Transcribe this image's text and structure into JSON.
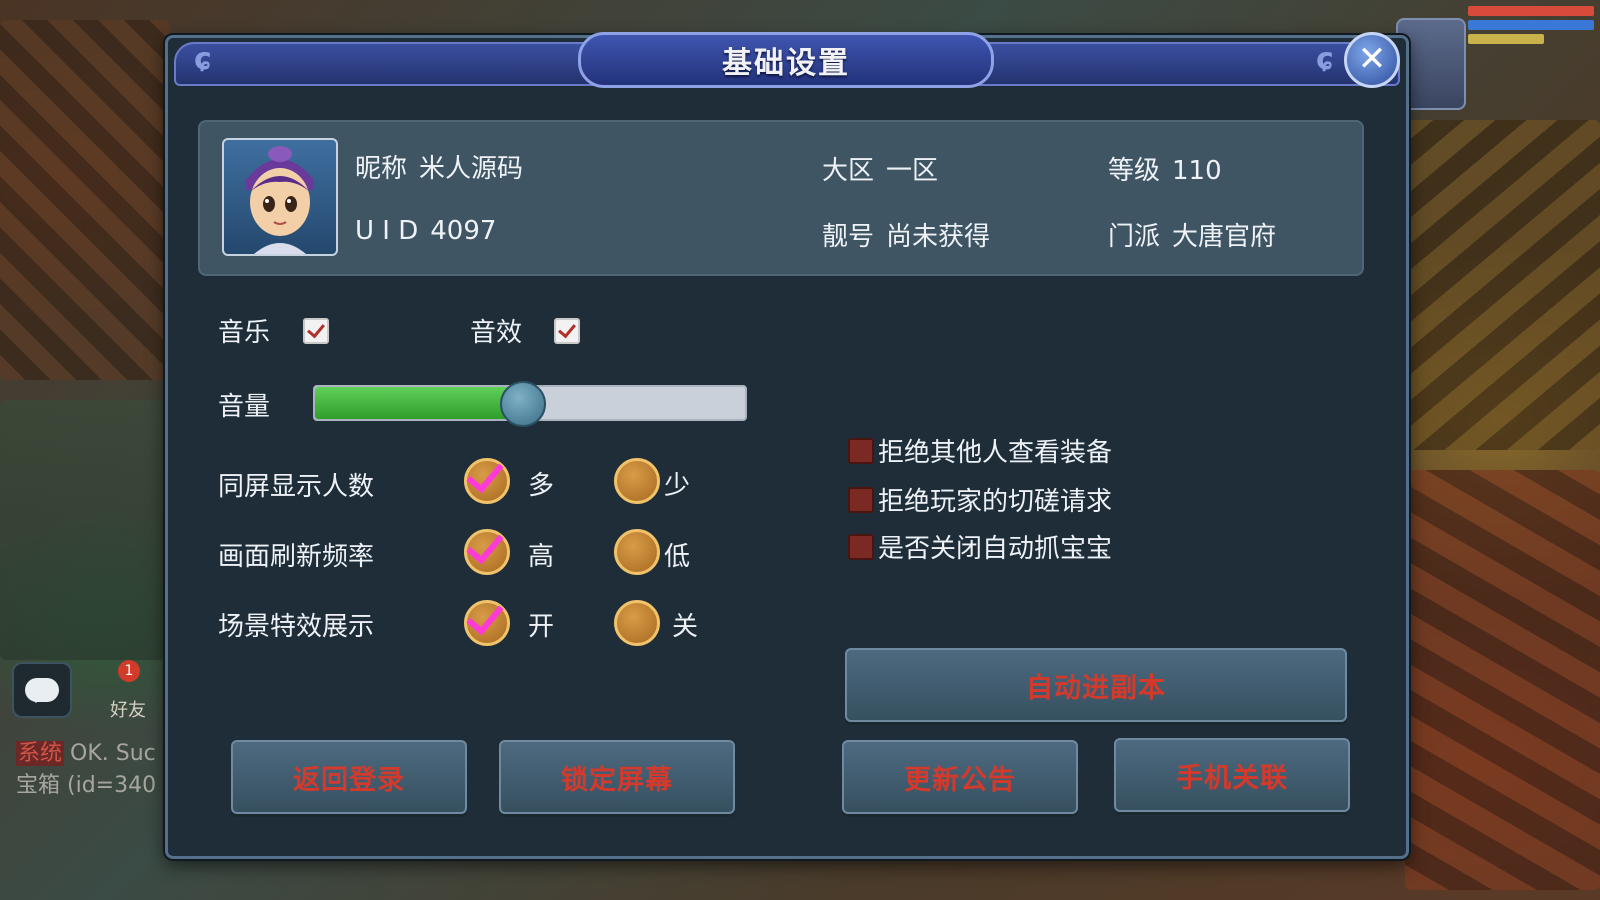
{
  "dialog": {
    "title": "基础设置",
    "close_icon": "✕"
  },
  "profile": {
    "nickname_label": "昵称",
    "nickname": "米人源码",
    "uid_label": "U I D",
    "uid": "4097",
    "region_label": "大区",
    "region": "一区",
    "handle_label": "靓号",
    "handle": "尚未获得",
    "level_label": "等级",
    "level": "110",
    "faction_label": "门派",
    "faction": "大唐官府"
  },
  "audio": {
    "music_label": "音乐",
    "music_checked": true,
    "sfx_label": "音效",
    "sfx_checked": true,
    "volume_label": "音量",
    "volume_fraction": 0.48
  },
  "display_options": [
    {
      "label": "同屏显示人数",
      "option_a": "多",
      "option_b": "少",
      "selected": "a"
    },
    {
      "label": "画面刷新频率",
      "option_a": "高",
      "option_b": "低",
      "selected": "a"
    },
    {
      "label": "场景特效展示",
      "option_a": "开",
      "option_b": "关",
      "selected": "a"
    }
  ],
  "privacy": {
    "refuse_view_equipment": "拒绝其他人查看装备",
    "refuse_duel": "拒绝玩家的切磋请求",
    "disable_auto_catch": "是否关闭自动抓宝宝"
  },
  "buttons": {
    "auto_dungeon": "自动进副本",
    "back_to_login": "返回登录",
    "lock_screen": "锁定屏幕",
    "update_notice": "更新公告",
    "phone_link": "手机关联"
  },
  "background": {
    "friend_label": "好友",
    "friend_badge": "1",
    "chat_tag": "系统",
    "chat_line1": "OK. Suc",
    "chat_line2": "宝箱 (id=340"
  },
  "colors": {
    "accent_red": "#d43a2c",
    "header_blue": "#3b4fa0",
    "panel_bg": "#1e2d38"
  }
}
